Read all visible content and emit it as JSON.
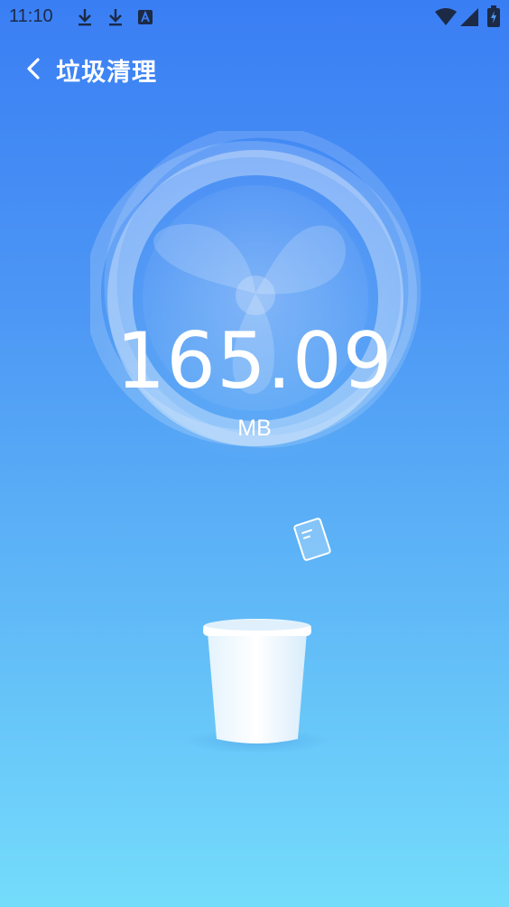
{
  "status_bar": {
    "time": "11:10",
    "icons": [
      "download-icon",
      "download-icon",
      "text-a-icon",
      "wifi-icon",
      "signal-icon",
      "battery-charging-icon"
    ]
  },
  "header": {
    "back_icon": "chevron-left-icon",
    "title": "垃圾清理"
  },
  "scan": {
    "size_value": "165.09",
    "size_unit": "MB"
  },
  "colors": {
    "background_top": "#3a7ef4",
    "background_bottom": "#74dcfb",
    "text": "#ffffff"
  }
}
